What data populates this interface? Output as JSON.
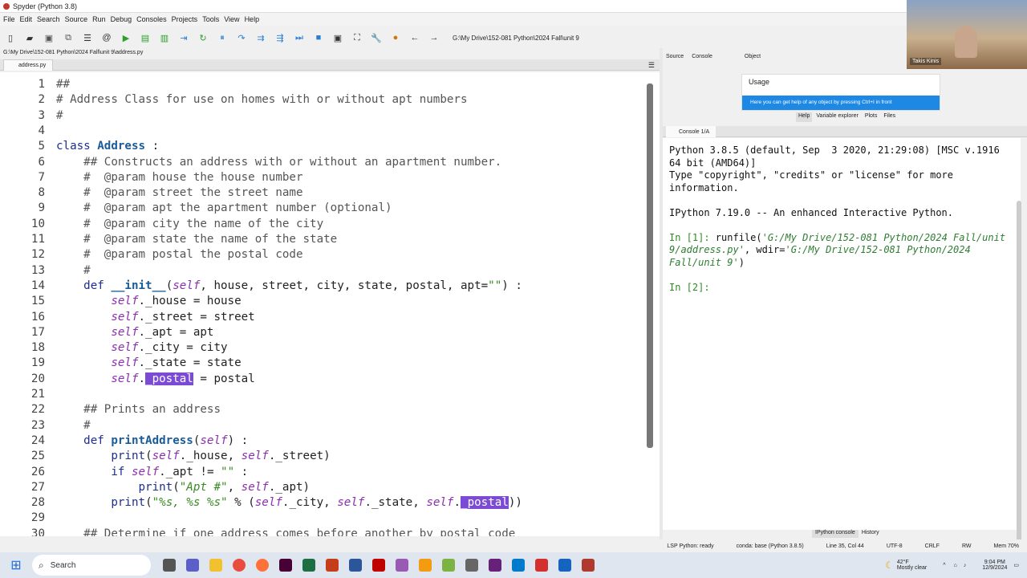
{
  "window": {
    "title": "Spyder (Python 3.8)"
  },
  "menu": [
    "File",
    "Edit",
    "Search",
    "Source",
    "Run",
    "Debug",
    "Consoles",
    "Projects",
    "Tools",
    "View",
    "Help"
  ],
  "toolbar": {
    "path": "G:\\My Drive\\152-081 Python\\2024 Fall\\unit 9"
  },
  "editor": {
    "file_path": "G:\\My Drive\\152-081 Python\\2024 Fall\\unit 9\\address.py",
    "tab_label": "address.py"
  },
  "help": {
    "source_label": "Source",
    "source_value": "Console",
    "object_label": "Object",
    "usage_title": "Usage",
    "usage_body": "Here you can get help of any object by pressing Ctrl+I in front",
    "tabs": [
      "Help",
      "Variable explorer",
      "Plots",
      "Files"
    ]
  },
  "console": {
    "tab_label": "Console 1/A",
    "banner1": "Python 3.8.5 (default, Sep  3 2020, 21:29:08) [MSC v.1916 64 bit (AMD64)]",
    "banner2": "Type \"copyright\", \"credits\" or \"license\" for more information.",
    "banner3": "IPython 7.19.0 -- An enhanced Interactive Python.",
    "prompt1": "In [1]:",
    "cmd1_a": " runfile(",
    "cmd1_b": "'G:/My Drive/152-081 Python/2024 Fall/unit 9/address.py'",
    "cmd1_c": ", wdir=",
    "cmd1_d": "'G:/My Drive/152-081 Python/2024 Fall/unit 9'",
    "cmd1_e": ")",
    "prompt2": "In [2]:",
    "bottom_tabs": [
      "IPython console",
      "History"
    ]
  },
  "status": {
    "lsp": "LSP Python: ready",
    "conda": "conda: base (Python 3.8.5)",
    "position": "Line 35, Col 44",
    "encoding": "UTF-8",
    "eol": "CRLF",
    "rw": "RW",
    "mem": "Mem 70%"
  },
  "taskbar": {
    "search": "Search",
    "weather_temp": "42°F",
    "weather_desc": "Mostly clear",
    "time": "9:04 PM",
    "date": "12/9/2024"
  },
  "webcam": {
    "name": "Takis Kinis"
  },
  "code": [
    "##",
    "# Address Class for use on homes with or without apt numbers",
    "#",
    "",
    "class Address :",
    "    ## Constructs an address with or without an apartment number.",
    "    #  @param house the house number",
    "    #  @param street the street name",
    "    #  @param apt the apartment number (optional)",
    "    #  @param city the name of the city",
    "    #  @param state the name of the state",
    "    #  @param postal the postal code",
    "    #",
    "    def __init__(self, house, street, city, state, postal, apt=\"\") :",
    "        self._house = house",
    "        self._street = street",
    "        self._apt = apt",
    "        self._city = city",
    "        self._state = state",
    "        self._postal = postal",
    "",
    "    ## Prints an address",
    "    #",
    "    def printAddress(self) :",
    "        print(self._house, self._street)",
    "        if self._apt != \"\" :",
    "            print(\"Apt #\", self._apt)",
    "        print(\"%s, %s %s\" % (self._city, self._state, self._postal))",
    "",
    "    ## Determine if one address comes before another by postal code"
  ]
}
